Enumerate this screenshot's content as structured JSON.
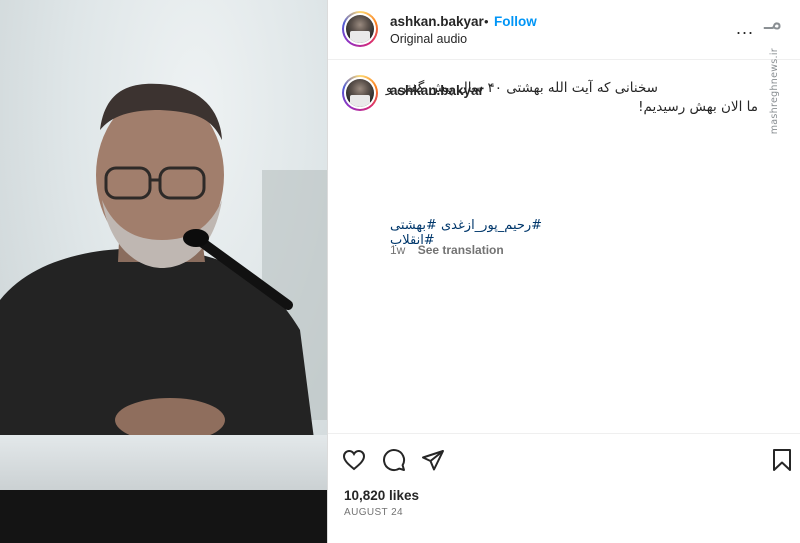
{
  "post": {
    "username": "ashkan.bakyar",
    "separator": "•",
    "follow_label": "Follow",
    "audio_label": "Original audio",
    "more_label": "...",
    "caption": "سخنانی که آیت الله بهشتی ۴۰ سال پیش گفتن و ما الان بهش رسیدیم!",
    "hashtags": "#رحیم_پور_ازغدی #بهشتی #انقلاب",
    "age": "1w",
    "see_translation": "See translation",
    "likes": "10,820 likes",
    "date": "AUGUST 24"
  },
  "watermark": {
    "brand": "ﻣـ",
    "site": "mashreghnews.ir"
  },
  "icons": {
    "like": "heart-icon",
    "comment": "comment-icon",
    "share": "share-icon",
    "save": "bookmark-icon",
    "more": "more-icon"
  },
  "colors": {
    "accent": "#0095f6",
    "hashtag": "#00376b",
    "muted": "#737373",
    "text": "#262626"
  }
}
